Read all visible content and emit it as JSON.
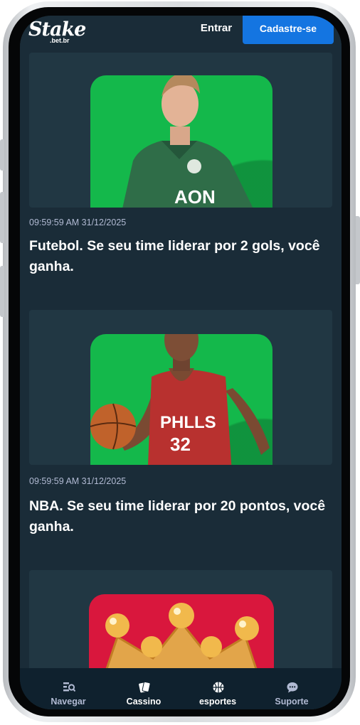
{
  "header": {
    "logo_text": "Stake",
    "logo_sub": ".bet.br",
    "login_label": "Entrar",
    "signup_label": "Cadastre-se"
  },
  "promos": [
    {
      "timestamp": "09:59:59 AM 31/12/2025",
      "title": "Futebol. Se seu time liderar por 2 gols, você ganha.",
      "jersey_text": "AON"
    },
    {
      "timestamp": "09:59:59 AM 31/12/2025",
      "title": "NBA. Se seu time liderar por 20 pontos, você ganha.",
      "jersey_text": "PHLLS",
      "jersey_number": "32"
    },
    {
      "timestamp": "",
      "title": ""
    }
  ],
  "bottom_nav": [
    {
      "label": "Navegar",
      "icon": "browse-icon"
    },
    {
      "label": "Cassino",
      "icon": "cards-icon"
    },
    {
      "label": "esportes",
      "icon": "basketball-icon"
    },
    {
      "label": "Suporte",
      "icon": "chat-icon"
    }
  ],
  "colors": {
    "background": "#1a2c38",
    "card": "#213743",
    "accent_blue": "#1475e1",
    "promo_green": "#14b84b",
    "promo_red": "#d9173d",
    "nav_bg": "#0f212e"
  }
}
